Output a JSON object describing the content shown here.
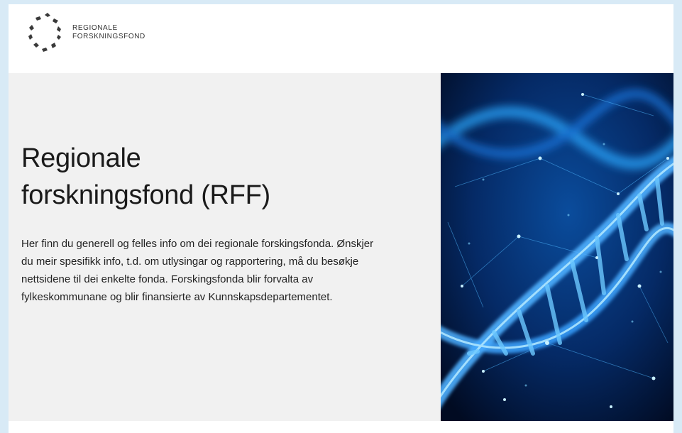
{
  "header": {
    "logo": {
      "icon": "rff-logo-icon",
      "line1": "REGIONALE",
      "line2": "FORSKNINGSFOND"
    }
  },
  "hero": {
    "title_line1": "Regionale",
    "title_line2": "forskningsfond (RFF)",
    "description": "Her finn du generell og felles info om dei regionale forskingsfonda. Ønskjer du meir spesifikk info, t.d. om utlysingar og rapportering, må du besøkje nettsidene til dei enkelte fonda. Forskingsfonda blir forvalta av fylkeskommunane og blir finansierte av Kunnskapsdepartementet.",
    "image": "dna-helix-image"
  },
  "colors": {
    "frame": "#d8eaf6",
    "hero_background": "#f1f1f1",
    "text": "#1a1a1a",
    "image_accent": "#1ea0ff"
  }
}
